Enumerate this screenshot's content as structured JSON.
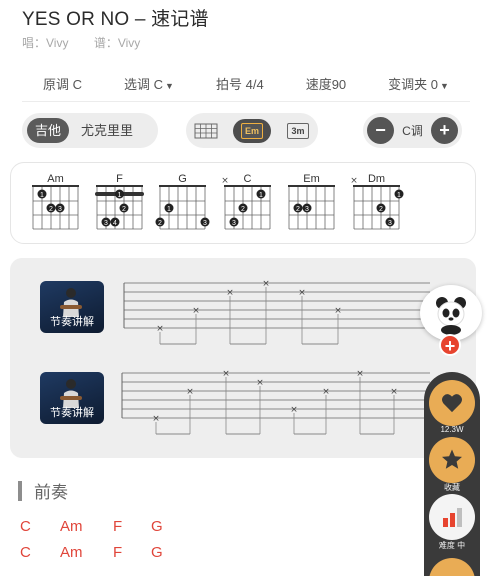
{
  "song": {
    "title": "YES OR NO – 速记谱",
    "singer": "唱：Vivy",
    "transcriber": "谱：Vivy"
  },
  "info": {
    "original_key": "原调 C",
    "select_key": "选调 C",
    "time_sig": "拍号 4/4",
    "tempo": "速度90",
    "capo": "变调夹 0"
  },
  "instrument": {
    "guitar": "吉他",
    "ukulele": "尤克里里",
    "selected": "guitar"
  },
  "view_modes": [
    {
      "label": "",
      "icon": "fretboard-grid-icon",
      "active": false
    },
    {
      "label": "Em",
      "icon": "chord-box-icon",
      "active": true
    },
    {
      "label": "3m",
      "icon": "chord-box-icon",
      "active": false
    }
  ],
  "key_control": {
    "minus": "−",
    "label": "C调",
    "plus": "+"
  },
  "chords": [
    {
      "name": "Am",
      "muted": [],
      "dots": [
        [
          5,
          1,
          "1"
        ],
        [
          4,
          2,
          "2"
        ],
        [
          3,
          2,
          "3"
        ]
      ],
      "barre": null
    },
    {
      "name": "F",
      "muted": [],
      "dots": [
        [
          3,
          2,
          "2"
        ],
        [
          5,
          3,
          "3"
        ],
        [
          4,
          3,
          "4"
        ]
      ],
      "barre": [
        1,
        "1"
      ]
    },
    {
      "name": "G",
      "muted": [],
      "dots": [
        [
          5,
          2,
          "1"
        ],
        [
          6,
          3,
          "2"
        ],
        [
          1,
          3,
          "3"
        ]
      ],
      "barre": null
    },
    {
      "name": "C",
      "muted": [
        6
      ],
      "dots": [
        [
          2,
          1,
          "1"
        ],
        [
          4,
          2,
          "2"
        ],
        [
          5,
          3,
          "3"
        ]
      ],
      "barre": null
    },
    {
      "name": "Em",
      "muted": [],
      "dots": [
        [
          5,
          2,
          "2"
        ],
        [
          4,
          2,
          "3"
        ]
      ],
      "barre": null
    },
    {
      "name": "Dm",
      "muted": [
        6
      ],
      "dots": [
        [
          1,
          1,
          "1"
        ],
        [
          3,
          2,
          "2"
        ],
        [
          2,
          3,
          "3"
        ]
      ],
      "barre": null
    }
  ],
  "videos": [
    {
      "caption": "节奏讲解"
    },
    {
      "caption": "节奏讲解"
    }
  ],
  "section": {
    "title": "前奏"
  },
  "chord_rows": [
    [
      "C",
      "Am",
      "F",
      "G"
    ],
    [
      "C",
      "Am",
      "F",
      "G"
    ]
  ],
  "side": {
    "like_count": "12.3W",
    "favorite": "收藏",
    "difficulty": "难度 中"
  },
  "colors": {
    "accent": "#e0453a",
    "gold": "#e9ac55",
    "panel": "#3a3a3a"
  }
}
